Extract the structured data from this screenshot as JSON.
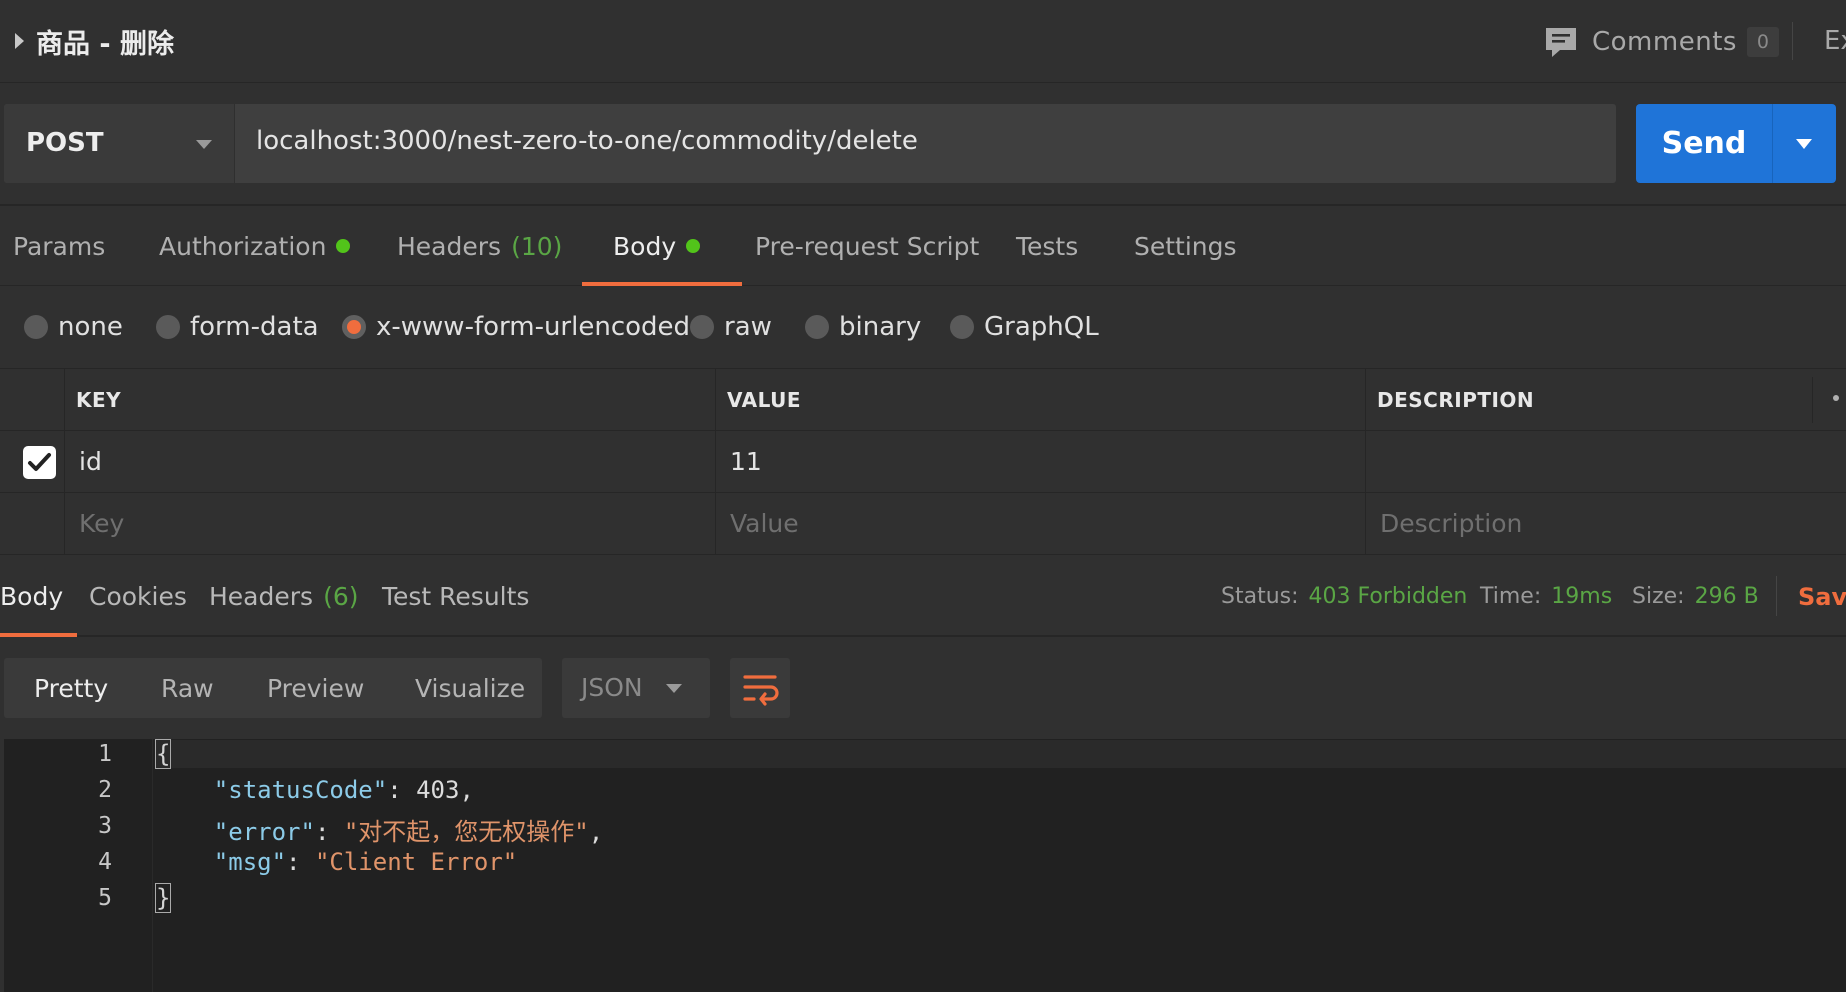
{
  "title_bar": {
    "request_name": "商品 - 删除",
    "comments_label": "Comments",
    "comments_count": "0",
    "ex_label": "Ex"
  },
  "request": {
    "method": "POST",
    "url": "localhost:3000/nest-zero-to-one/commodity/delete",
    "send_label": "Send"
  },
  "request_tabs": [
    {
      "label": "Params"
    },
    {
      "label": "Authorization",
      "dot": true
    },
    {
      "label": "Headers",
      "count": "(10)"
    },
    {
      "label": "Body",
      "dot": true,
      "active": true
    },
    {
      "label": "Pre-request Script"
    },
    {
      "label": "Tests"
    },
    {
      "label": "Settings"
    }
  ],
  "body_types": [
    {
      "label": "none"
    },
    {
      "label": "form-data"
    },
    {
      "label": "x-www-form-urlencoded",
      "selected": true
    },
    {
      "label": "raw"
    },
    {
      "label": "binary"
    },
    {
      "label": "GraphQL"
    }
  ],
  "params_table": {
    "headers": {
      "key": "KEY",
      "value": "VALUE",
      "description": "DESCRIPTION"
    },
    "rows": [
      {
        "checked": true,
        "key": "id",
        "value": "11",
        "description": ""
      }
    ],
    "placeholders": {
      "key": "Key",
      "value": "Value",
      "description": "Description"
    }
  },
  "response_tabs": [
    {
      "label": "Body",
      "active": true
    },
    {
      "label": "Cookies"
    },
    {
      "label": "Headers",
      "count": "(6)"
    },
    {
      "label": "Test Results"
    }
  ],
  "response_status": {
    "status_label": "Status:",
    "status_value": "403 Forbidden",
    "time_label": "Time:",
    "time_value": "19ms",
    "size_label": "Size:",
    "size_value": "296 B",
    "save_label": "Save"
  },
  "format_toolbar": {
    "modes": [
      "Pretty",
      "Raw",
      "Preview",
      "Visualize"
    ],
    "active_mode": "Pretty",
    "language": "JSON"
  },
  "response_body": {
    "line_numbers": [
      "1",
      "2",
      "3",
      "4",
      "5"
    ],
    "open_brace": "{",
    "close_brace": "}",
    "fields": [
      {
        "key": "\"statusCode\"",
        "value": "403",
        "value_type": "number",
        "trailing": ","
      },
      {
        "key": "\"error\"",
        "value": "\"对不起，您无权操作\"",
        "value_type": "string",
        "trailing": ","
      },
      {
        "key": "\"msg\"",
        "value": "\"Client Error\"",
        "value_type": "string",
        "trailing": ""
      }
    ]
  },
  "colors": {
    "accent_orange": "#f06d3e",
    "send_blue": "#1f74d8",
    "status_green": "#5aa645",
    "dot_green": "#52c41a"
  }
}
